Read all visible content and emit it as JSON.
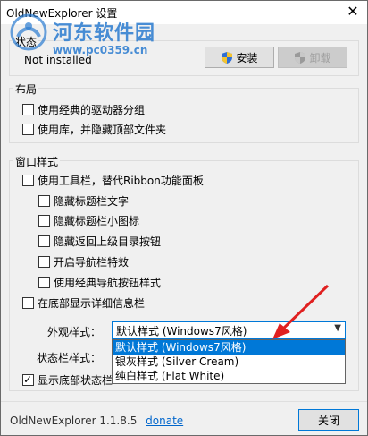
{
  "window": {
    "title": "OldNewExplorer 设置",
    "close_glyph": "✕"
  },
  "watermark": {
    "name": "河东软件园",
    "url": "www.pc0359.cn"
  },
  "status_group": {
    "label": "状态",
    "value": "Not installed",
    "install_label": "安装",
    "uninstall_label": "卸载"
  },
  "layout_group": {
    "label": "布局",
    "options": [
      {
        "label": "使用经典的驱动器分组",
        "checked": false
      },
      {
        "label": "使用库，并隐藏顶部文件夹",
        "checked": false
      }
    ]
  },
  "window_style_group": {
    "label": "窗口样式",
    "toolbar_option": {
      "label": "使用工具栏，替代Ribbon功能面板",
      "checked": false
    },
    "sub_options": [
      {
        "label": "隐藏标题栏文字",
        "checked": false
      },
      {
        "label": "隐藏标题栏小图标",
        "checked": false
      },
      {
        "label": "隐藏返回上级目录按钮",
        "checked": false
      },
      {
        "label": "开启导航栏特效",
        "checked": false
      },
      {
        "label": "使用经典导航按钮样式",
        "checked": false
      }
    ],
    "details_option": {
      "label": "在底部显示详细信息栏",
      "checked": false
    },
    "appearance_label": "外观样式：",
    "appearance_value": "默认样式 (Windows7风格)",
    "statusbar_label": "状态栏样式：",
    "dropdown_options": [
      "默认样式 (Windows7风格)",
      "银灰样式 (Silver Cream)",
      "纯白样式 (Flat White)"
    ],
    "show_statusbar_option": {
      "label": "显示底部状态栏",
      "checked": true
    }
  },
  "footer": {
    "version": "OldNewExplorer 1.1.8.5",
    "donate_label": "donate",
    "close_label": "关闭"
  },
  "colors": {
    "accent": "#0078d7",
    "watermark": "#2a7bd0",
    "arrow": "#e02020"
  }
}
